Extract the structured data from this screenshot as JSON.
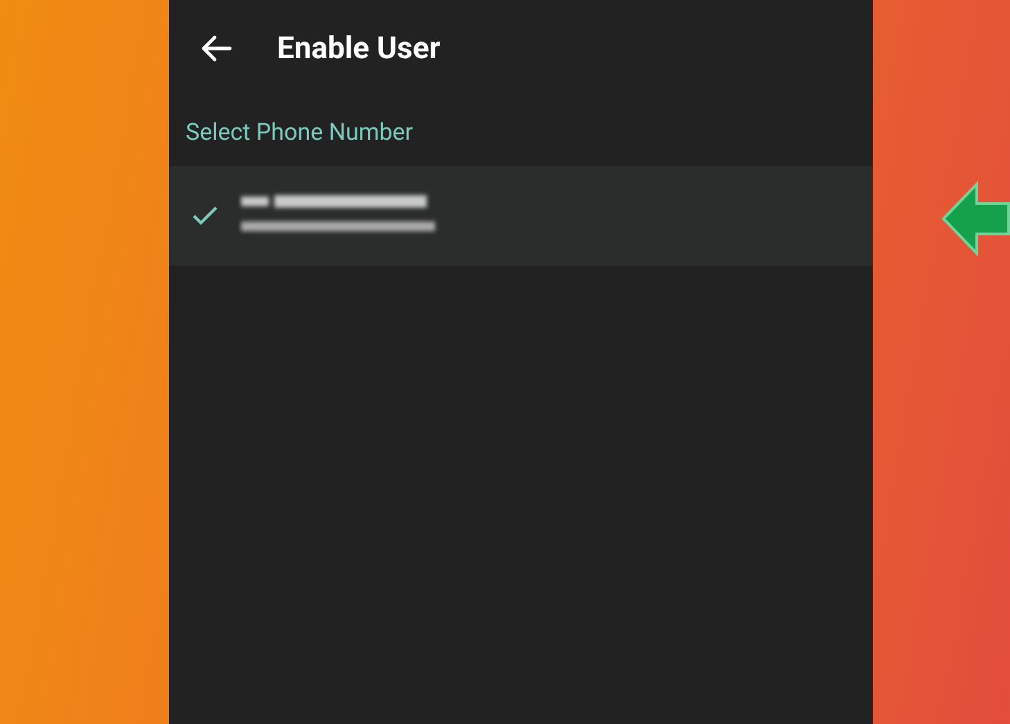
{
  "header": {
    "title": "Enable User"
  },
  "section_label": "Select Phone Number",
  "phone_numbers": [
    {
      "selected": true
    }
  ]
}
